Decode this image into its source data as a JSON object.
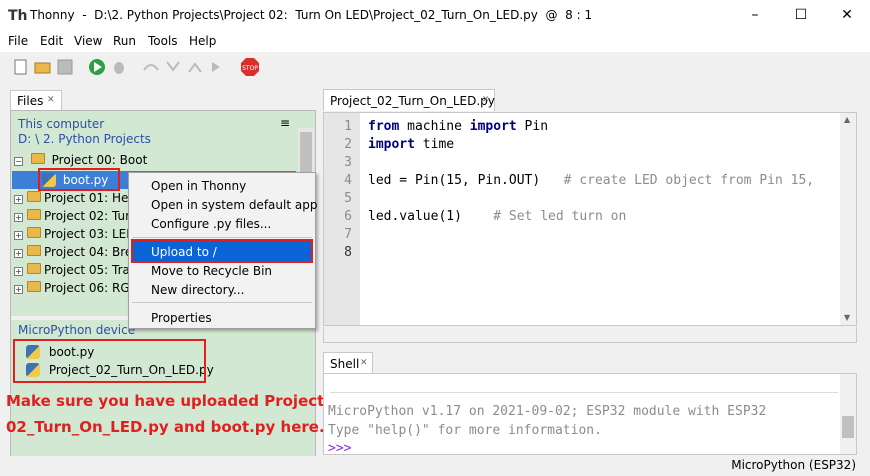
{
  "window": {
    "title": "Thonny  -  D:\\2. Python Projects\\Project 02:  Turn On LED\\Project_02_Turn_On_LED.py  @  8 : 1",
    "app_icon": "thonny-icon",
    "minimize": "–",
    "maximize": "☐",
    "close": "✕"
  },
  "menu": [
    "File",
    "Edit",
    "View",
    "Run",
    "Tools",
    "Help"
  ],
  "toolbar": [
    "new-file-icon",
    "open-file-icon",
    "save-icon",
    "run-icon",
    "debug-icon",
    "step-over-icon",
    "step-into-icon",
    "step-out-icon",
    "resume-icon",
    "stop-icon"
  ],
  "files": {
    "tab": "Files",
    "tab_close": "✕",
    "menu_glyph": "≡",
    "this_computer": "This computer",
    "path": "D: \\ 2. Python Projects",
    "tree": [
      {
        "label": "Project 00:  Boot",
        "expanded": true
      },
      {
        "label": "boot.py",
        "selected": true
      },
      {
        "label": "Project 01:  He"
      },
      {
        "label": "Project 02:  Tur"
      },
      {
        "label": "Project 03:  LEI"
      },
      {
        "label": "Project 04:  Bre"
      },
      {
        "label": "Project 05:  Tra"
      },
      {
        "label": "Project 06:  RG"
      }
    ],
    "device": "MicroPython device",
    "device_files": [
      "boot.py",
      "Project_02_Turn_On_LED.py"
    ]
  },
  "context_menu": [
    "Open in Thonny",
    "Open in system default app",
    "Configure .py files...",
    "Upload to /",
    "Move to Recycle Bin",
    "New directory...",
    "Properties"
  ],
  "annotation": [
    "Make sure you have uploaded Project_",
    "02_Turn_On_LED.py and boot.py here."
  ],
  "editor": {
    "tab": "Project_02_Turn_On_LED.py",
    "tab_close": "✕",
    "lines": [
      {
        "n": "1",
        "kw1": "from",
        "t1": " machine ",
        "kw2": "import",
        "t2": " Pin",
        "cm": ""
      },
      {
        "n": "2",
        "kw1": "import",
        "t1": " time",
        "kw2": "",
        "t2": "",
        "cm": ""
      },
      {
        "n": "3",
        "kw1": "",
        "t1": "",
        "kw2": "",
        "t2": "",
        "cm": ""
      },
      {
        "n": "4",
        "kw1": "",
        "t1": "led = Pin(15, Pin.OUT)   ",
        "kw2": "",
        "t2": "",
        "cm": "# create LED object from Pin 15,"
      },
      {
        "n": "5",
        "kw1": "",
        "t1": "",
        "kw2": "",
        "t2": "",
        "cm": ""
      },
      {
        "n": "6",
        "kw1": "",
        "t1": "led.value(1)    ",
        "kw2": "",
        "t2": "",
        "cm": "# Set led turn on"
      },
      {
        "n": "7",
        "kw1": "",
        "t1": "",
        "kw2": "",
        "t2": "",
        "cm": ""
      },
      {
        "n": "8",
        "kw1": "",
        "t1": "",
        "kw2": "",
        "t2": "",
        "cm": ""
      }
    ]
  },
  "shell": {
    "tab": "Shell",
    "tab_close": "✕",
    "lines": [
      "MicroPython v1.17 on 2021-09-02; ESP32 module with ESP32",
      "Type \"help()\" for more information.",
      ">>>"
    ]
  },
  "status": "MicroPython (ESP32)"
}
